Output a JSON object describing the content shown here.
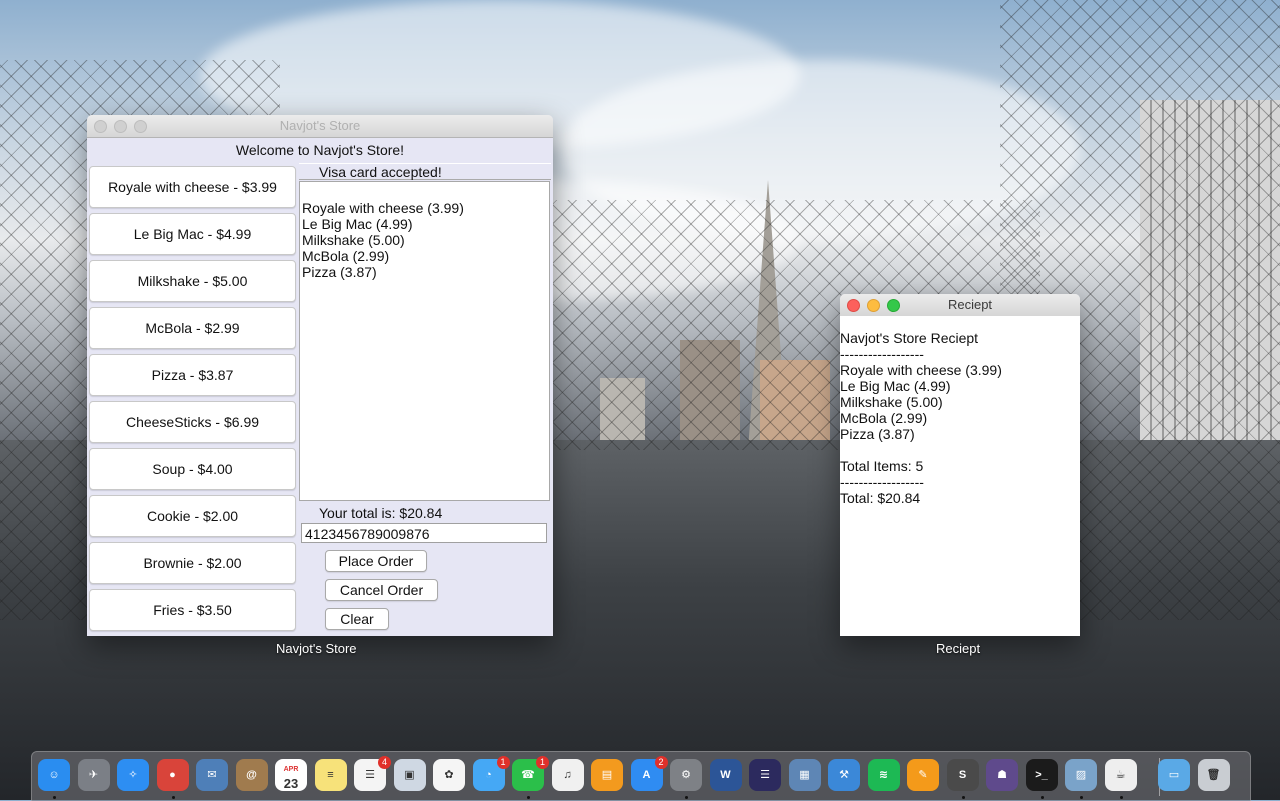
{
  "store_window": {
    "title": "Navjot's Store",
    "welcome": "Welcome to Navjot's Store!",
    "menu_items": [
      "Royale with cheese - $3.99",
      "Le Big Mac - $4.99",
      "Milkshake - $5.00",
      "McBola - $2.99",
      "Pizza - $3.87",
      "CheeseSticks - $6.99",
      "Soup - $4.00",
      "Cookie - $2.00",
      "Brownie - $2.00",
      "Fries - $3.50"
    ],
    "status": "Visa card accepted!",
    "order_lines": [
      "Royale with cheese (3.99)",
      "Le Big Mac (4.99)",
      "Milkshake (5.00)",
      "McBola (2.99)",
      "Pizza (3.87)"
    ],
    "total": "Your total is: $20.84",
    "card_number": "4123456789009876",
    "place_order": "Place Order",
    "cancel_order": "Cancel Order",
    "clear": "Clear",
    "label": "Navjot's Store"
  },
  "receipt_window": {
    "title": "Reciept",
    "lines": [
      "Navjot's Store Reciept",
      "------------------",
      "Royale with cheese (3.99)",
      "Le Big Mac (4.99)",
      "Milkshake (5.00)",
      "McBola (2.99)",
      "Pizza (3.87)",
      "",
      "Total Items: 5",
      "------------------",
      "Total: $20.84"
    ],
    "label": "Reciept"
  },
  "dock": {
    "apps": [
      {
        "name": "finder-icon",
        "color": "#2a8df0",
        "glyph": "☺"
      },
      {
        "name": "launchpad-icon",
        "color": "#7b7f86",
        "glyph": "✈"
      },
      {
        "name": "safari-icon",
        "color": "#2d8ef2",
        "glyph": "✧"
      },
      {
        "name": "chrome-icon",
        "color": "#d9443a",
        "glyph": "●"
      },
      {
        "name": "mail-bird-icon",
        "color": "#4e7fb8",
        "glyph": "✉"
      },
      {
        "name": "contacts-icon",
        "color": "#a07b4e",
        "glyph": "@"
      },
      {
        "name": "calendar-icon",
        "color": "#ffffff",
        "glyph": "23",
        "sub": "APR"
      },
      {
        "name": "notes-icon",
        "color": "#f7e27a",
        "glyph": "≡"
      },
      {
        "name": "reminders-icon",
        "color": "#f4f4f4",
        "glyph": "☰",
        "badge": "4"
      },
      {
        "name": "preview-icon",
        "color": "#cfd8e3",
        "glyph": "▣"
      },
      {
        "name": "photos-icon",
        "color": "#f5f5f5",
        "glyph": "✿"
      },
      {
        "name": "messages-icon",
        "color": "#45a8f5",
        "glyph": "◔",
        "badge": "1"
      },
      {
        "name": "facetime-icon",
        "color": "#2bbf4a",
        "glyph": "☎",
        "badge": "1"
      },
      {
        "name": "itunes-icon",
        "color": "#f0f0f0",
        "glyph": "♫"
      },
      {
        "name": "ibooks-icon",
        "color": "#f39a1e",
        "glyph": "▤"
      },
      {
        "name": "app-store-icon",
        "color": "#2f8cf2",
        "glyph": "A",
        "badge": "2"
      },
      {
        "name": "system-preferences-icon",
        "color": "#7e8186",
        "glyph": "⚙"
      },
      {
        "name": "word-icon",
        "color": "#2c5597",
        "glyph": "W"
      },
      {
        "name": "eclipse-icon",
        "color": "#2c2a5e",
        "glyph": "☰"
      },
      {
        "name": "virtualbox-icon",
        "color": "#5e86b5",
        "glyph": "▦"
      },
      {
        "name": "xcode-icon",
        "color": "#3b88d8",
        "glyph": "⚒"
      },
      {
        "name": "spotify-icon",
        "color": "#1db954",
        "glyph": "≋"
      },
      {
        "name": "fl-studio-icon",
        "color": "#f49a1a",
        "glyph": "✎"
      },
      {
        "name": "sublime-text-icon",
        "color": "#4a4a4a",
        "glyph": "S"
      },
      {
        "name": "github-icon",
        "color": "#5f4a8c",
        "glyph": "☗"
      },
      {
        "name": "terminal-icon",
        "color": "#1b1b1b",
        "glyph": ">_"
      },
      {
        "name": "image-capture-icon",
        "color": "#7aa3c9",
        "glyph": "▨"
      },
      {
        "name": "java-icon",
        "color": "#eeeeee",
        "glyph": "☕"
      },
      {
        "name": "folder-icon",
        "color": "#5aa9e6",
        "glyph": "▭"
      },
      {
        "name": "trash-icon",
        "color": "#c9cdd2",
        "glyph": "🗑"
      }
    ]
  }
}
